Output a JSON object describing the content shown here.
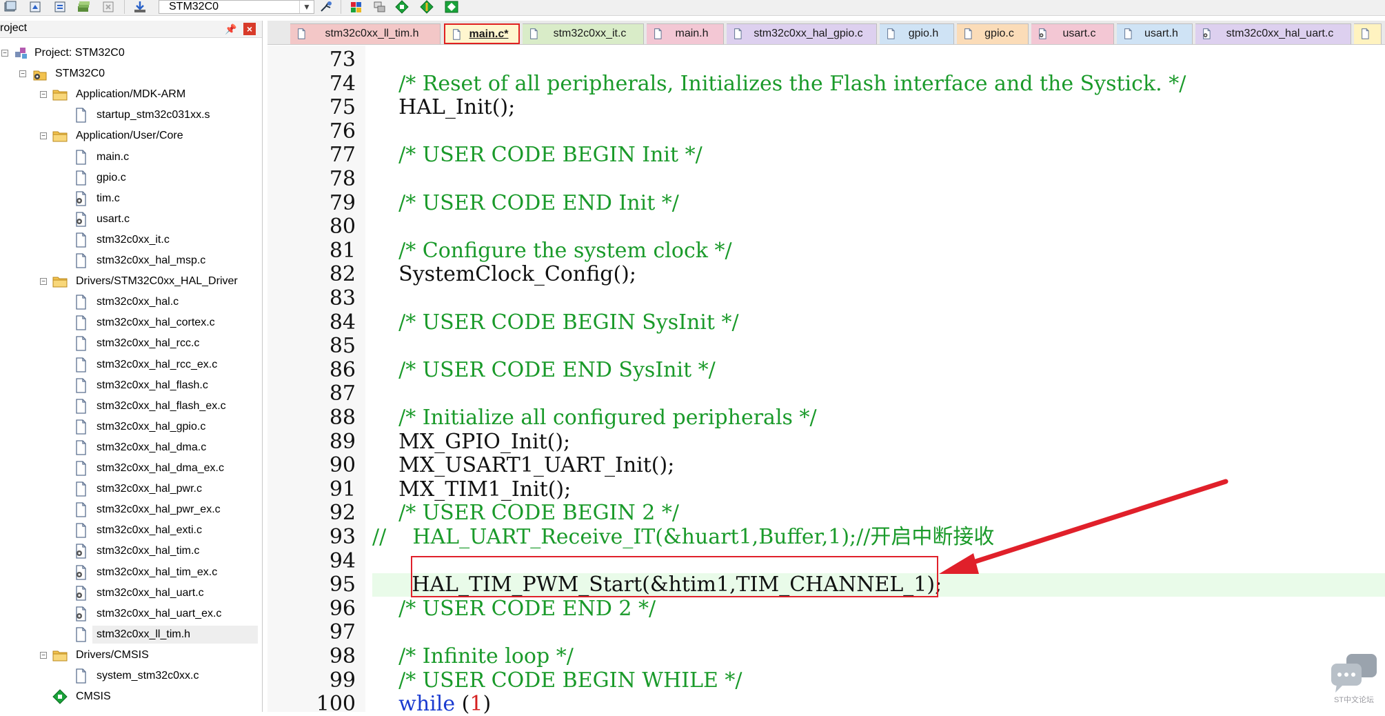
{
  "toolbar": {
    "target_name": "STM32C0",
    "icons": [
      "build-all-icon",
      "translate-icon",
      "rebuild-icon",
      "batch-build-icon",
      "stop-build-icon",
      "download-icon",
      "options-icon",
      "manage-components-icon",
      "file-extensions-icon",
      "select-packs-icon",
      "event-recorder-icon",
      "pack-installer-icon"
    ]
  },
  "project_panel": {
    "title": "roject",
    "close_label": "×",
    "tree": [
      {
        "label": "Project: STM32C0",
        "level": 0,
        "expander": "−",
        "icon": "project-icon"
      },
      {
        "label": "STM32C0",
        "level": 1,
        "expander": "−",
        "icon": "target-icon"
      },
      {
        "label": "Application/MDK-ARM",
        "level": 2,
        "expander": "−",
        "icon": "folder-icon"
      },
      {
        "label": "startup_stm32c031xx.s",
        "level": 3,
        "icon": "file-icon"
      },
      {
        "label": "Application/User/Core",
        "level": 2,
        "expander": "−",
        "icon": "folder-icon"
      },
      {
        "label": "main.c",
        "level": 3,
        "icon": "file-icon"
      },
      {
        "label": "gpio.c",
        "level": 3,
        "icon": "file-icon"
      },
      {
        "label": "tim.c",
        "level": 3,
        "icon": "file-gear-icon"
      },
      {
        "label": "usart.c",
        "level": 3,
        "icon": "file-gear-icon"
      },
      {
        "label": "stm32c0xx_it.c",
        "level": 3,
        "icon": "file-icon"
      },
      {
        "label": "stm32c0xx_hal_msp.c",
        "level": 3,
        "icon": "file-icon"
      },
      {
        "label": "Drivers/STM32C0xx_HAL_Driver",
        "level": 2,
        "expander": "−",
        "icon": "folder-icon"
      },
      {
        "label": "stm32c0xx_hal.c",
        "level": 3,
        "icon": "file-icon"
      },
      {
        "label": "stm32c0xx_hal_cortex.c",
        "level": 3,
        "icon": "file-icon"
      },
      {
        "label": "stm32c0xx_hal_rcc.c",
        "level": 3,
        "icon": "file-icon"
      },
      {
        "label": "stm32c0xx_hal_rcc_ex.c",
        "level": 3,
        "icon": "file-icon"
      },
      {
        "label": "stm32c0xx_hal_flash.c",
        "level": 3,
        "icon": "file-icon"
      },
      {
        "label": "stm32c0xx_hal_flash_ex.c",
        "level": 3,
        "icon": "file-icon"
      },
      {
        "label": "stm32c0xx_hal_gpio.c",
        "level": 3,
        "icon": "file-icon"
      },
      {
        "label": "stm32c0xx_hal_dma.c",
        "level": 3,
        "icon": "file-icon"
      },
      {
        "label": "stm32c0xx_hal_dma_ex.c",
        "level": 3,
        "icon": "file-icon"
      },
      {
        "label": "stm32c0xx_hal_pwr.c",
        "level": 3,
        "icon": "file-icon"
      },
      {
        "label": "stm32c0xx_hal_pwr_ex.c",
        "level": 3,
        "icon": "file-icon"
      },
      {
        "label": "stm32c0xx_hal_exti.c",
        "level": 3,
        "icon": "file-icon"
      },
      {
        "label": "stm32c0xx_hal_tim.c",
        "level": 3,
        "icon": "file-gear-icon"
      },
      {
        "label": "stm32c0xx_hal_tim_ex.c",
        "level": 3,
        "icon": "file-gear-icon"
      },
      {
        "label": "stm32c0xx_hal_uart.c",
        "level": 3,
        "icon": "file-gear-icon"
      },
      {
        "label": "stm32c0xx_hal_uart_ex.c",
        "level": 3,
        "icon": "file-gear-icon"
      },
      {
        "label": "stm32c0xx_ll_tim.h",
        "level": 3,
        "icon": "file-icon",
        "selected": true
      },
      {
        "label": "Drivers/CMSIS",
        "level": 2,
        "expander": "−",
        "icon": "folder-icon"
      },
      {
        "label": "system_stm32c0xx.c",
        "level": 3,
        "icon": "file-icon"
      },
      {
        "label": "CMSIS",
        "level": 2,
        "icon": "cmsis-diamond-icon"
      }
    ]
  },
  "tabs": [
    {
      "label": "stm32c0xx_ll_tim.h",
      "color": "#f3c7c7",
      "icon": "file-icon"
    },
    {
      "label": "main.c*",
      "color": "#fff6cf",
      "icon": "file-icon",
      "active": true
    },
    {
      "label": "stm32c0xx_it.c",
      "color": "#d9ecc8",
      "icon": "file-icon"
    },
    {
      "label": "main.h",
      "color": "#f3c7d4",
      "icon": "file-icon"
    },
    {
      "label": "stm32c0xx_hal_gpio.c",
      "color": "#ddd0ef",
      "icon": "file-icon"
    },
    {
      "label": "gpio.h",
      "color": "#cfe3f5",
      "icon": "file-icon"
    },
    {
      "label": "gpio.c",
      "color": "#fbdcb8",
      "icon": "file-icon"
    },
    {
      "label": "usart.c",
      "color": "#f3c7d4",
      "icon": "file-gear-icon"
    },
    {
      "label": "usart.h",
      "color": "#cfe3f5",
      "icon": "file-icon"
    },
    {
      "label": "stm32c0xx_hal_uart.c",
      "color": "#ddd0ef",
      "icon": "file-gear-icon"
    },
    {
      "label": "",
      "color": "#fff3c0",
      "icon": "file-icon"
    }
  ],
  "code": {
    "lines": [
      {
        "num": "73",
        "segments": []
      },
      {
        "num": "74",
        "segments": [
          {
            "t": "    /* Reset of all peripherals, Initializes the Flash interface and the Systick. */",
            "c": "comment"
          }
        ]
      },
      {
        "num": "75",
        "segments": [
          {
            "t": "    HAL_Init();",
            "c": "plain"
          }
        ]
      },
      {
        "num": "76",
        "segments": []
      },
      {
        "num": "77",
        "segments": [
          {
            "t": "    /* USER CODE BEGIN Init */",
            "c": "comment"
          }
        ]
      },
      {
        "num": "78",
        "segments": []
      },
      {
        "num": "79",
        "segments": [
          {
            "t": "    /* USER CODE END Init */",
            "c": "comment"
          }
        ]
      },
      {
        "num": "80",
        "segments": []
      },
      {
        "num": "81",
        "segments": [
          {
            "t": "    /* Configure the system clock */",
            "c": "comment"
          }
        ]
      },
      {
        "num": "82",
        "segments": [
          {
            "t": "    SystemClock_Config();",
            "c": "plain"
          }
        ]
      },
      {
        "num": "83",
        "segments": []
      },
      {
        "num": "84",
        "segments": [
          {
            "t": "    /* USER CODE BEGIN SysInit */",
            "c": "comment"
          }
        ]
      },
      {
        "num": "85",
        "segments": []
      },
      {
        "num": "86",
        "segments": [
          {
            "t": "    /* USER CODE END SysInit */",
            "c": "comment"
          }
        ]
      },
      {
        "num": "87",
        "segments": []
      },
      {
        "num": "88",
        "segments": [
          {
            "t": "    /* Initialize all configured peripherals */",
            "c": "comment"
          }
        ]
      },
      {
        "num": "89",
        "segments": [
          {
            "t": "    MX_GPIO_Init();",
            "c": "plain"
          }
        ]
      },
      {
        "num": "90",
        "segments": [
          {
            "t": "    MX_USART1_UART_Init();",
            "c": "plain"
          }
        ]
      },
      {
        "num": "91",
        "segments": [
          {
            "t": "    MX_TIM1_Init();",
            "c": "plain"
          }
        ]
      },
      {
        "num": "92",
        "segments": [
          {
            "t": "    /* USER CODE BEGIN 2 */",
            "c": "comment"
          }
        ]
      },
      {
        "num": "93",
        "segments": [
          {
            "t": "//    HAL_UART_Receive_IT(&huart1,Buffer,1);//开启中断接收",
            "c": "comment"
          }
        ]
      },
      {
        "num": "94",
        "segments": []
      },
      {
        "num": "95",
        "segments": [
          {
            "t": "      HAL_TIM_PWM_Start(&htim1,TIM_CHANNEL_1);",
            "c": "plain"
          }
        ],
        "current": true
      },
      {
        "num": "96",
        "segments": [
          {
            "t": "    /* USER CODE END 2 */",
            "c": "comment"
          }
        ]
      },
      {
        "num": "97",
        "segments": []
      },
      {
        "num": "98",
        "segments": [
          {
            "t": "    /* Infinite loop */",
            "c": "comment"
          }
        ]
      },
      {
        "num": "99",
        "segments": [
          {
            "t": "    /* USER CODE BEGIN WHILE */",
            "c": "comment"
          }
        ]
      },
      {
        "num": "100",
        "segments": [
          {
            "t": "    ",
            "c": "plain"
          },
          {
            "t": "while",
            "c": "keyword"
          },
          {
            "t": " (",
            "c": "plain"
          },
          {
            "t": "1",
            "c": "number"
          },
          {
            "t": ")",
            "c": "plain"
          }
        ]
      }
    ]
  },
  "colors": {
    "comment": "#1a9a2a",
    "keyword": "#1a3bd0",
    "number": "#d42020",
    "annotation": "#e0202a"
  },
  "watermark": {
    "text": "ST中文论坛"
  }
}
